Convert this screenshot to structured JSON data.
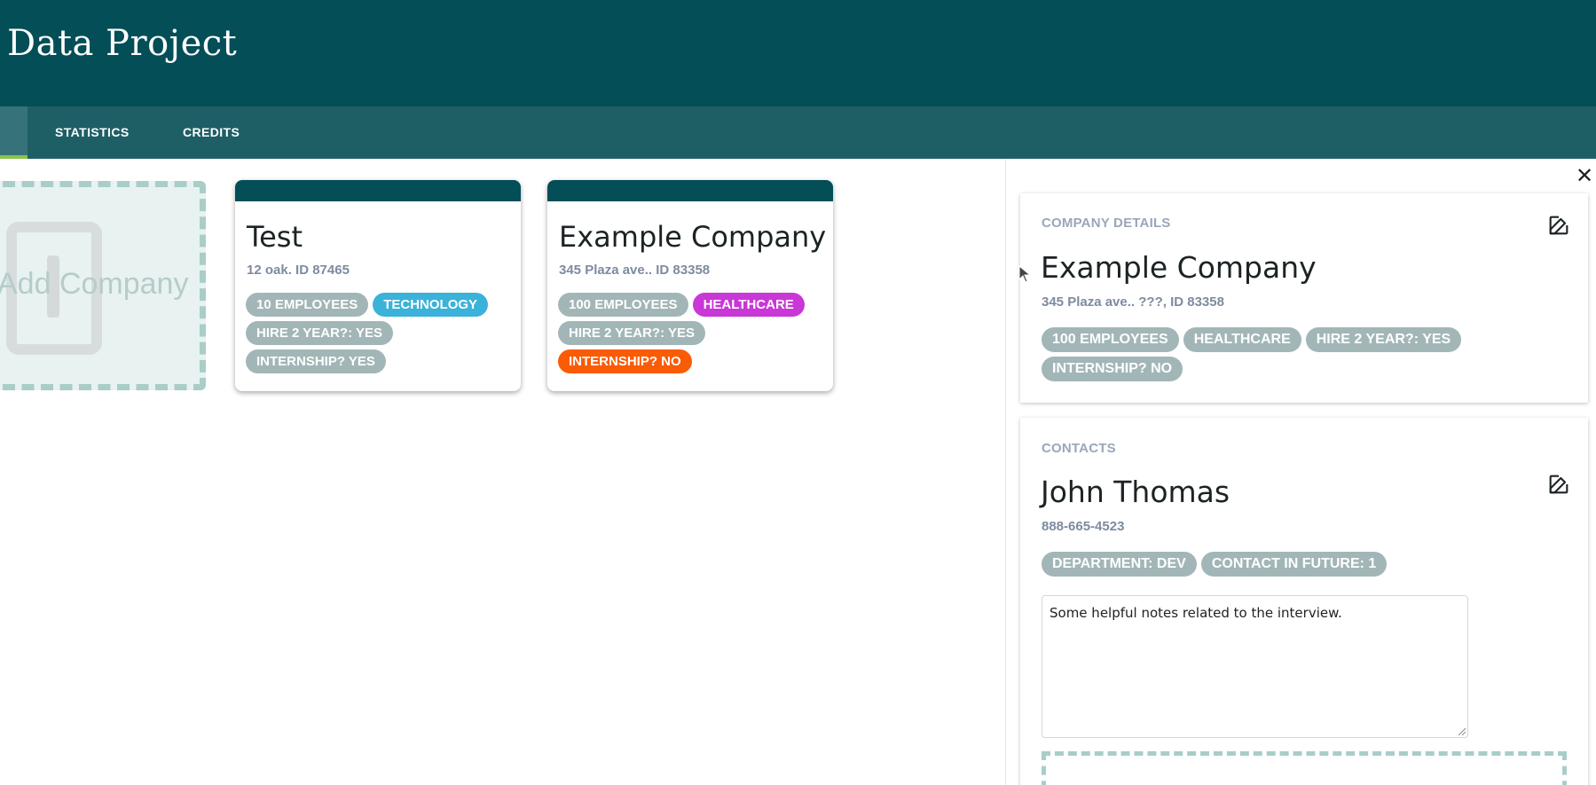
{
  "app": {
    "title": "Data Project"
  },
  "nav": {
    "tabs": [
      {
        "label": ""
      },
      {
        "label": "STATISTICS"
      },
      {
        "label": "CREDITS"
      }
    ]
  },
  "add_company": {
    "label": "Add Company"
  },
  "companies": [
    {
      "name": "Test",
      "subtitle": "12 oak. ID 87465",
      "tags": [
        "10 EMPLOYEES",
        "TECHNOLOGY",
        "HIRE 2 YEAR?: YES",
        "INTERNSHIP? YES"
      ]
    },
    {
      "name": "Example Company",
      "subtitle": "345 Plaza ave.. ID 83358",
      "tags": [
        "100 EMPLOYEES",
        "HEALTHCARE",
        "HIRE 2 YEAR?: YES",
        "INTERNSHIP? NO"
      ]
    }
  ],
  "details": {
    "section_label": "COMPANY DETAILS",
    "name": "Example Company",
    "subtitle": "345 Plaza ave.. ???, ID 83358",
    "tags": [
      "100 EMPLOYEES",
      "HEALTHCARE",
      "HIRE 2 YEAR?: YES",
      "INTERNSHIP? NO"
    ]
  },
  "contacts": {
    "section_label": "CONTACTS",
    "name": "John Thomas",
    "phone": "888-665-4523",
    "tags": [
      "DEPARTMENT: DEV",
      "CONTACT IN FUTURE: 1"
    ],
    "notes": "Some helpful notes related to the interview."
  },
  "icons": {
    "close": "close-icon",
    "edit": "edit-icon",
    "add": "add-icon",
    "cursor": "cursor-icon"
  },
  "colors": {
    "header": "#034e57",
    "navbar": "#1e5f66",
    "tag_default": "#a2b6b7",
    "tag_technology": "#3bb2d9",
    "tag_healthcare": "#c937d6",
    "tag_internship_no": "#fa5b05",
    "active_tab_indicator": "#8bc34a"
  }
}
